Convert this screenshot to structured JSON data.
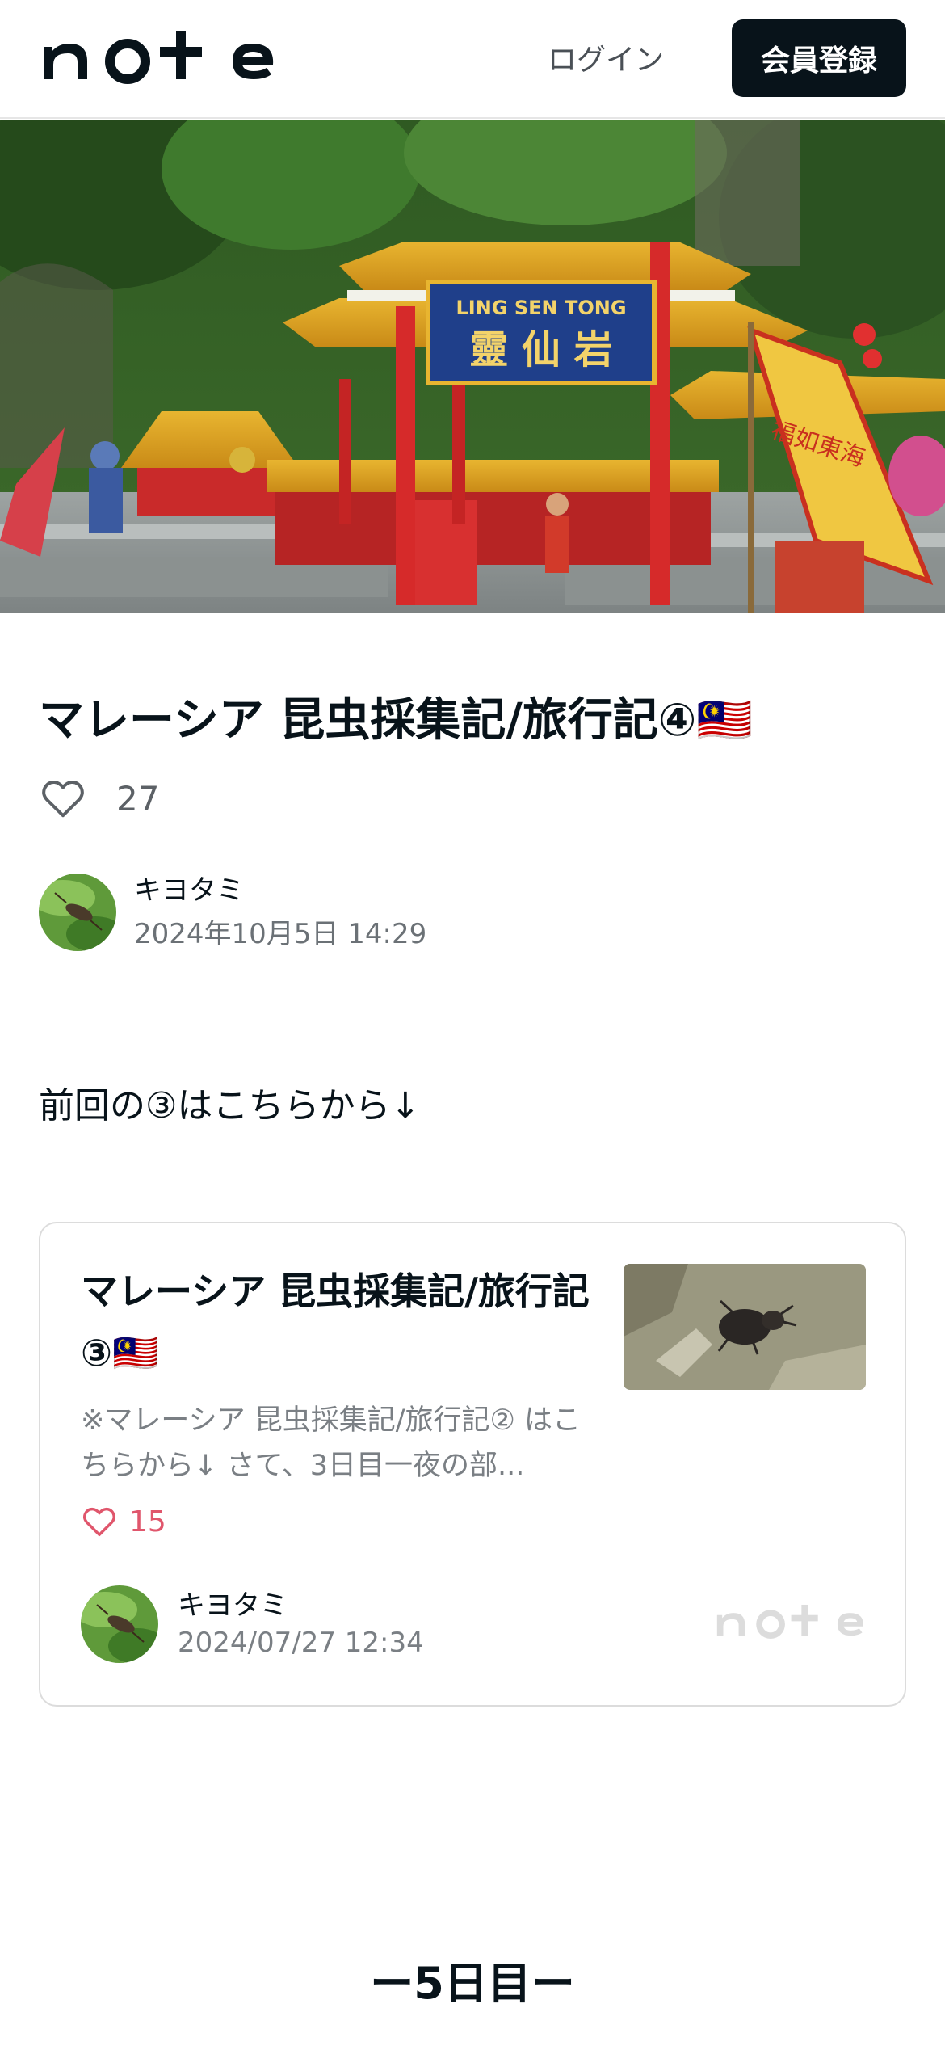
{
  "header": {
    "logo_alt": "note",
    "login_label": "ログイン",
    "signup_label": "会員登録"
  },
  "hero": {
    "sign_top": "LING SEN TONG",
    "sign_chinese": "靈 仙 岩",
    "flag_text": "福如東海"
  },
  "article": {
    "title": "マレーシア 昆虫採集記/旅行記④🇲🇾",
    "like_count": "27",
    "author_name": "キヨタミ",
    "published": "2024年10月5日 14:29",
    "intro": "前回の③はこちらから↓",
    "section_heading": "ー5日目ー"
  },
  "embed": {
    "title": "マレーシア 昆虫採集記/旅行記③🇲🇾",
    "excerpt": "※マレーシア 昆虫採集記/旅行記② はこちらから↓ さて、3日目一夜の部...",
    "like_count": "15",
    "author_name": "キヨタミ",
    "date": "2024/07/27 12:34"
  },
  "colors": {
    "primary": "#08131a",
    "like_accent": "#e0566c",
    "muted": "#7a7f84",
    "border": "#dcdcdc"
  },
  "icons": {
    "like": "heart-outline-icon",
    "card_like": "heart-outline-icon"
  }
}
